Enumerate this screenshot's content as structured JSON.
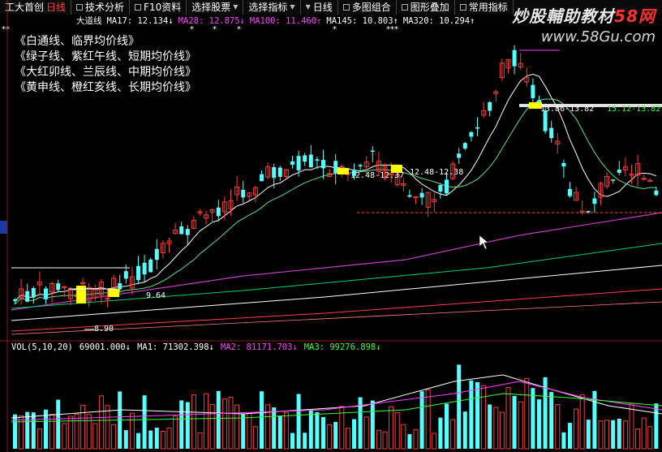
{
  "toolbar": {
    "stock": "工大首创",
    "period": "日线",
    "tabs": [
      "技术分析",
      "F10资料",
      "选择股票",
      "选择指标",
      "日线",
      "多图组合",
      "图形叠加",
      "常用指标"
    ]
  },
  "indicator": {
    "name": "大道线",
    "ma17": "MA17: 12.134↓",
    "ma28": "MA28: 12.875↓",
    "ma100": "MA100: 11.460↑",
    "ma145": "MA145: 10.803↑",
    "ma320": "MA320: 10.294↑"
  },
  "notes": [
    "《白通线、临界均价线》",
    "《绿子线、紫红午线、短期均价线》",
    "《大红卯线、兰辰线、中期均价线》",
    "《黄申线、橙红亥线、长期均价线》"
  ],
  "watermark": {
    "line1_a": "炒股輔助教材",
    "line1_b": "58网",
    "line2": "www.58Gu.com"
  },
  "price_labels": {
    "low": "8.90",
    "mid1": "9.64",
    "mid2": "12.48-12.37",
    "mid3": "12.48-12.38",
    "high1": "13.86-13.82",
    "high2": "15.12-13.82",
    "left_marker": "↓"
  },
  "volume": {
    "title": "VOL(5,10,20)",
    "vol": "69001.000↓",
    "ma1": "MA1: 71302.398↓",
    "ma2": "MA2: 81171.703↓",
    "ma3": "MA3: 99276.898↓"
  },
  "colors": {
    "up": "#ff3b3b",
    "down": "#54ffff",
    "ma17": "#ffffff",
    "ma28": "#ff40ff",
    "ma100": "#00ff00",
    "ma145": "#ffffff",
    "ma320": "#ff4040",
    "highlight": "#ffff00"
  }
}
